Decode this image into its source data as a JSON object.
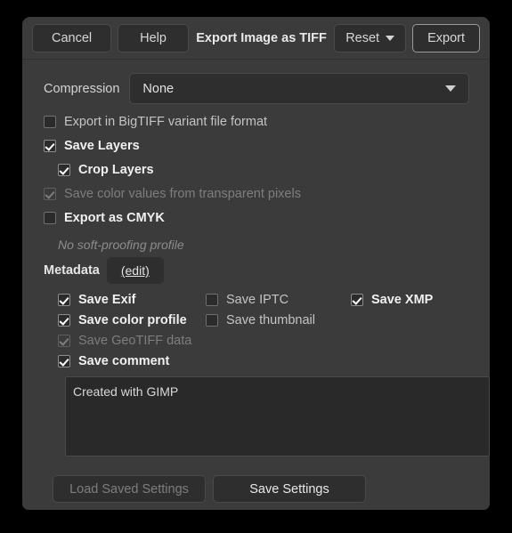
{
  "window": {
    "title": "Export Image as TIFF"
  },
  "header": {
    "cancel_label": "Cancel",
    "help_label": "Help",
    "title": "Export Image as TIFF",
    "reset_label": "Reset",
    "export_label": "Export"
  },
  "compression": {
    "label": "Compression",
    "value": "None",
    "options": [
      "None"
    ]
  },
  "options": [
    {
      "label": "Export in BigTIFF variant file format",
      "checked": false,
      "enabled": true,
      "indent": 0
    },
    {
      "label": "Save Layers",
      "checked": true,
      "enabled": true,
      "indent": 0
    },
    {
      "label": "Crop Layers",
      "checked": true,
      "enabled": true,
      "indent": 1
    },
    {
      "label": "Save color values from transparent pixels",
      "checked": true,
      "enabled": false,
      "indent": 0
    },
    {
      "label": "Export as CMYK",
      "checked": false,
      "enabled": true,
      "indent": 0
    }
  ],
  "softproof": {
    "note": "No soft-proofing profile"
  },
  "metadata": {
    "label": "Metadata",
    "edit_label": "(edit)",
    "items": [
      {
        "label": "Save Exif",
        "checked": true,
        "enabled": true,
        "col": 1,
        "row": 1
      },
      {
        "label": "Save color profile",
        "checked": true,
        "enabled": true,
        "col": 1,
        "row": 2
      },
      {
        "label": "Save GeoTIFF data",
        "checked": true,
        "enabled": false,
        "col": 1,
        "row": 3
      },
      {
        "label": "Save comment",
        "checked": true,
        "enabled": true,
        "col": 1,
        "row": 4
      },
      {
        "label": "Save IPTC",
        "checked": false,
        "enabled": true,
        "col": 2,
        "row": 1
      },
      {
        "label": "Save thumbnail",
        "checked": false,
        "enabled": true,
        "col": 2,
        "row": 2
      },
      {
        "label": "Save XMP",
        "checked": true,
        "enabled": true,
        "col": 3,
        "row": 1
      }
    ]
  },
  "comment": {
    "value": "Created with GIMP"
  },
  "footer": {
    "load_label": "Load Saved Settings",
    "save_label": "Save Settings"
  },
  "colors": {
    "window_bg": "#3b3b3b",
    "control_bg": "#2e2e2e",
    "field_bg": "#292929",
    "border": "#4a4a4a",
    "text": "#e2e2e2",
    "text_dim": "#7e7e7e",
    "desktop_bg": "#000000"
  }
}
